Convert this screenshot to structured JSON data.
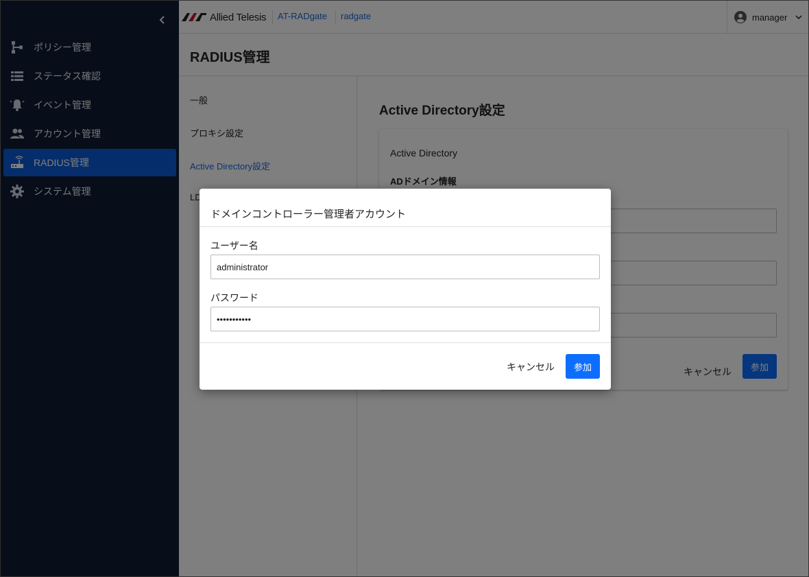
{
  "header": {
    "brand": "Allied Telesis",
    "product": "AT-RADgate",
    "device": "radgate",
    "user": "manager"
  },
  "sidebar": {
    "items": [
      {
        "label": "ポリシー管理",
        "icon": "policy-tree-icon"
      },
      {
        "label": "ステータス確認",
        "icon": "list-icon"
      },
      {
        "label": "イベント管理",
        "icon": "alarm-icon"
      },
      {
        "label": "アカウント管理",
        "icon": "people-icon"
      },
      {
        "label": "RADIUS管理",
        "icon": "router-icon",
        "active": true
      },
      {
        "label": "システム管理",
        "icon": "gear-icon"
      }
    ]
  },
  "page": {
    "title": "RADIUS管理"
  },
  "subnav": {
    "items": [
      "一般",
      "プロキシ設定",
      "Active Directory設定",
      "LD"
    ]
  },
  "content": {
    "title": "Active Directory設定",
    "card_title": "Active Directory",
    "section_title": "ADドメイン情報",
    "cancel_label": "キャンセル",
    "join_label": "参加"
  },
  "modal": {
    "title": "ドメインコントローラー管理者アカウント",
    "username_label": "ユーザー名",
    "username_value": "administrator",
    "password_label": "パスワード",
    "password_value": "•••••••••••",
    "cancel_label": "キャンセル",
    "join_label": "参加"
  },
  "colors": {
    "sidebar_bg": "#0f1c33",
    "accent": "#0d6efd",
    "link": "#1a66d9"
  }
}
